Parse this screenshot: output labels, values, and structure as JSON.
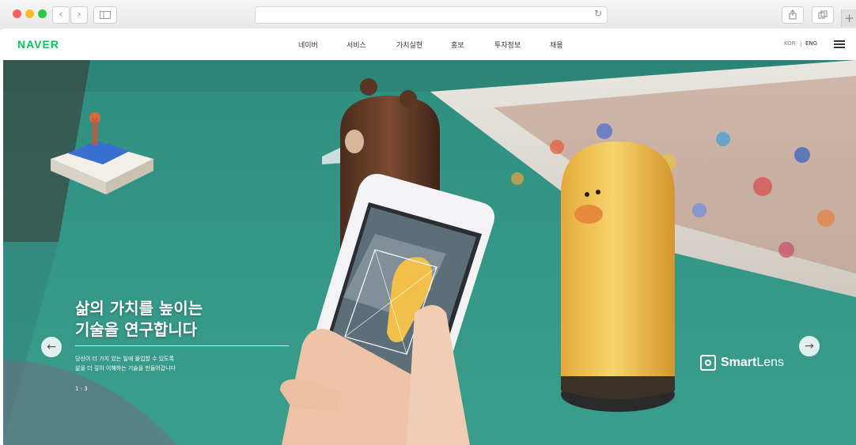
{
  "browser": {
    "back_icon": "chevron-left-icon",
    "forward_icon": "chevron-right-icon",
    "sidebar_icon": "sidebar-icon",
    "reload_icon": "reload-icon",
    "share_icon": "share-icon",
    "tabs_icon": "tabs-icon",
    "new_tab_icon": "plus-icon"
  },
  "header": {
    "logo": "NAVER",
    "nav": [
      "네이버",
      "서비스",
      "가치실현",
      "홍보",
      "투자정보",
      "채용"
    ],
    "lang": [
      "KOR",
      "ENG"
    ],
    "menu_icon": "hamburger-icon"
  },
  "hero": {
    "headline_line1": "삶의 가치를 높이는",
    "headline_line2": "기술을 연구합니다",
    "subtext_line1": "당신이 더 가치 있는 일에 몰입할 수 있도록",
    "subtext_line2": "삶을 더 깊이 이해하는 기술을 만들어갑니다",
    "counter": "1 : 3",
    "prev_icon": "arrow-left-icon",
    "next_icon": "arrow-right-icon",
    "badge_bold": "Smart",
    "badge_light": "Lens"
  },
  "colors": {
    "brand": "#03c75a",
    "table_green": "#2e9a86"
  }
}
